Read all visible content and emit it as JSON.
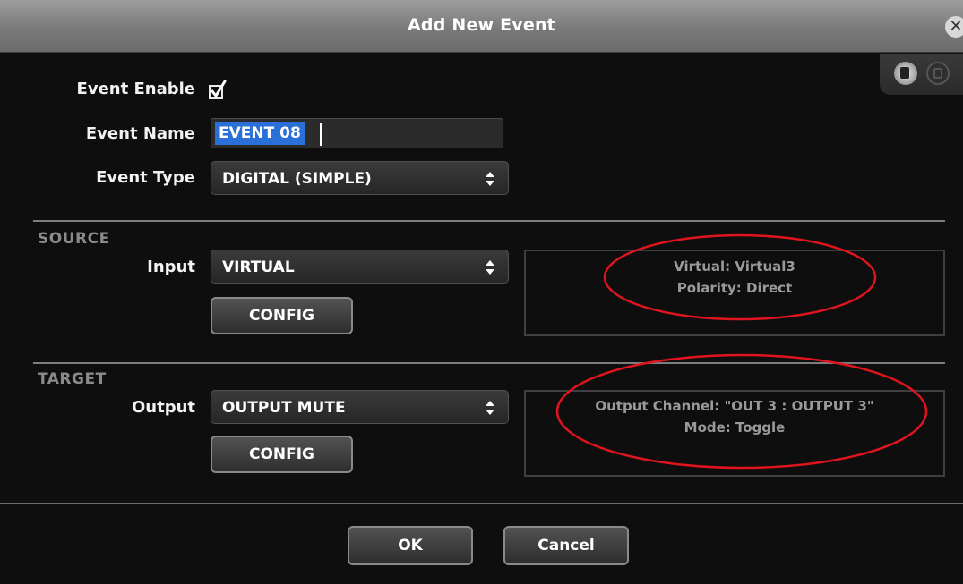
{
  "dialog": {
    "title": "Add New Event",
    "close_glyph": "✕"
  },
  "general": {
    "event_enable_label": "Event Enable",
    "event_enable_checked": true,
    "event_name_label": "Event Name",
    "event_name_value": "EVENT 08",
    "event_type_label": "Event Type",
    "event_type_value": "DIGITAL (SIMPLE)"
  },
  "source": {
    "section_title": "SOURCE",
    "input_label": "Input",
    "input_value": "VIRTUAL",
    "config_label": "CONFIG",
    "info_line1": "Virtual: Virtual3",
    "info_line2": "Polarity: Direct"
  },
  "target": {
    "section_title": "TARGET",
    "output_label": "Output",
    "output_value": "OUTPUT MUTE",
    "config_label": "CONFIG",
    "info_line1": "Output Channel: \"OUT 3 : OUTPUT 3\"",
    "info_line2": "Mode: Toggle"
  },
  "footer": {
    "ok_label": "OK",
    "cancel_label": "Cancel"
  },
  "icons": {
    "corner_left": "copy-icon",
    "corner_right": "paste-icon"
  },
  "colors": {
    "annotation": "#e0141e",
    "selection": "#2b6fd8"
  }
}
